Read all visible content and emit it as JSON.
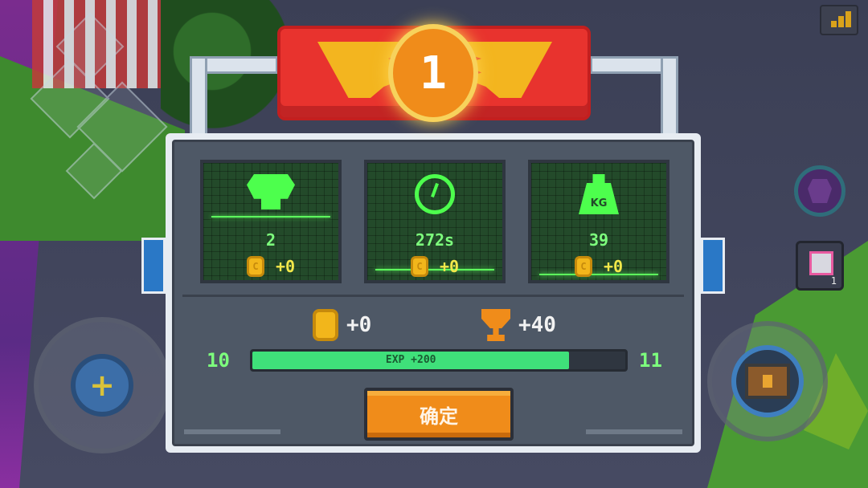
{
  "hud": {
    "item_count": "1"
  },
  "result": {
    "rank": "1",
    "stats": [
      {
        "icon": "skull-icon",
        "value": "2",
        "reward": "+0"
      },
      {
        "icon": "clock-icon",
        "value": "272s",
        "reward": "+0"
      },
      {
        "icon": "weight-icon",
        "icon_text": "KG",
        "value": "39",
        "reward": "+0"
      }
    ],
    "total_coins": "+0",
    "total_trophies": "+40",
    "level_current": "10",
    "level_next": "11",
    "exp_label": "EXP +200",
    "exp_fill": 0.85,
    "confirm_label": "确定"
  },
  "colors": {
    "panel_green": "#234a2a",
    "text_green": "#7dff7d",
    "coin_gold": "#f2b61b",
    "button_orange": "#f08c1a",
    "banner_red": "#e8332e"
  }
}
